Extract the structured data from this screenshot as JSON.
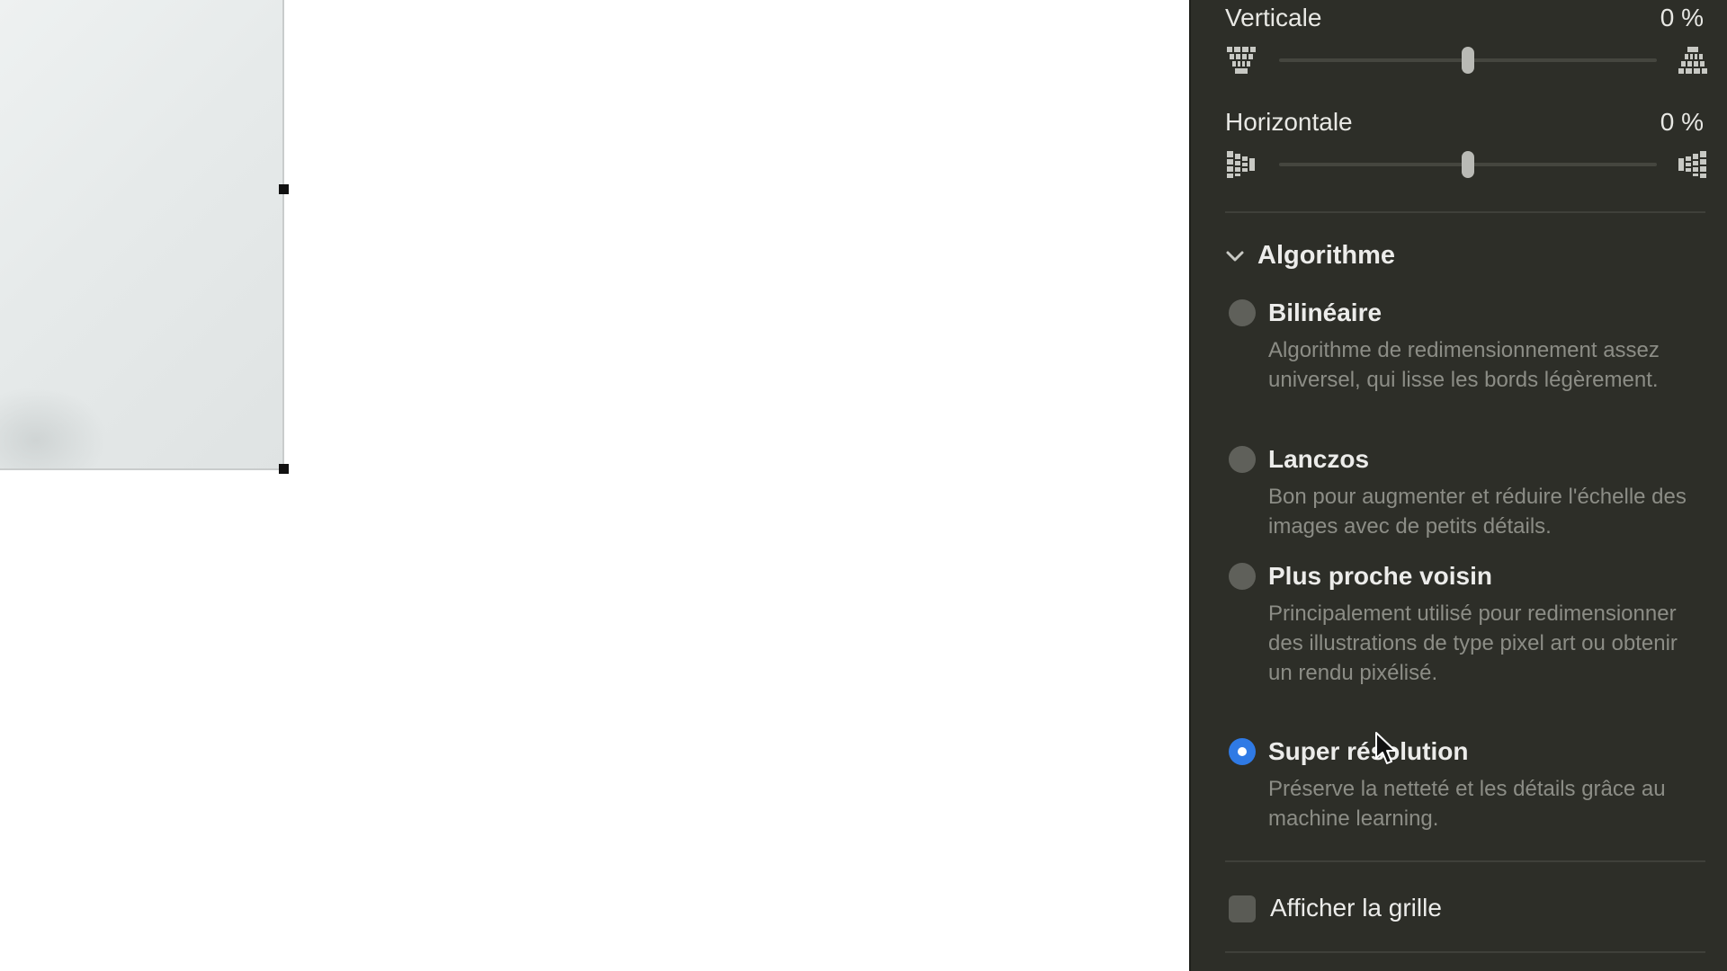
{
  "panel": {
    "vertical": {
      "label": "Verticale",
      "value": "0 %",
      "level": 0.5
    },
    "horizontal": {
      "label": "Horizontale",
      "value": "0 %",
      "level": 0.5
    },
    "algorithm": {
      "section_label": "Algorithme",
      "options": [
        {
          "label": "Bilinéaire",
          "description": "Algorithme de redimensionnement assez universel, qui lisse les bords légèrement.",
          "selected": false
        },
        {
          "label": "Lanczos",
          "description": "Bon pour augmenter et réduire l'échelle des images avec de petits détails.",
          "selected": false
        },
        {
          "label": "Plus proche voisin",
          "description": "Principalement utilisé pour redimensionner des illustrations de type pixel art ou obtenir un rendu pixélisé.",
          "selected": false
        },
        {
          "label": "Super résolution",
          "description": "Préserve la netteté et les détails grâce au machine learning.",
          "selected": true
        }
      ]
    },
    "grid": {
      "label": "Afficher la grille",
      "checked": false
    }
  },
  "colors": {
    "panel_bg": "#2d2e28",
    "accent": "#2f7ae5",
    "text_primary": "#ececea",
    "text_secondary": "#8c8d86"
  },
  "icons": [
    "vertical-perspective-narrow-icon",
    "vertical-perspective-wide-icon",
    "horizontal-perspective-narrow-icon",
    "horizontal-perspective-wide-icon",
    "chevron-down-icon",
    "mouse-cursor-icon"
  ]
}
